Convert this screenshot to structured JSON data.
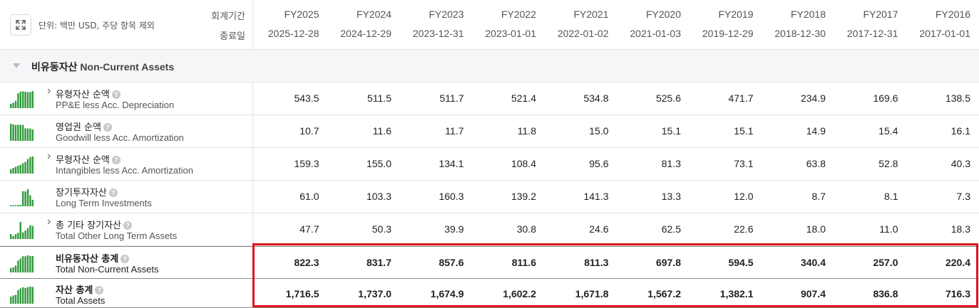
{
  "header": {
    "unit_label": "단위: 백만 USD, 주당 항목 제외",
    "period_label": "회계기간",
    "end_date_label": "종료일",
    "columns": [
      {
        "fy": "FY2025",
        "date": "2025-12-28"
      },
      {
        "fy": "FY2024",
        "date": "2024-12-29"
      },
      {
        "fy": "FY2023",
        "date": "2023-12-31"
      },
      {
        "fy": "FY2022",
        "date": "2023-01-01"
      },
      {
        "fy": "FY2021",
        "date": "2022-01-02"
      },
      {
        "fy": "FY2020",
        "date": "2021-01-03"
      },
      {
        "fy": "FY2019",
        "date": "2019-12-29"
      },
      {
        "fy": "FY2018",
        "date": "2018-12-30"
      },
      {
        "fy": "FY2017",
        "date": "2017-12-31"
      },
      {
        "fy": "FY2016",
        "date": "2017-01-01"
      }
    ]
  },
  "section": {
    "title_ko": "비유동자산",
    "title_en": "Non-Current Assets"
  },
  "rows": [
    {
      "name_ko": "유형자산 순액",
      "name_en": "PP&E less Acc. Depreciation",
      "expandable": true,
      "total": false,
      "values": [
        "543.5",
        "511.5",
        "511.7",
        "521.4",
        "534.8",
        "525.6",
        "471.7",
        "234.9",
        "169.6",
        "138.5"
      ]
    },
    {
      "name_ko": "영업권 순액",
      "name_en": "Goodwill less Acc. Amortization",
      "expandable": false,
      "total": false,
      "values": [
        "10.7",
        "11.6",
        "11.7",
        "11.8",
        "15.0",
        "15.1",
        "15.1",
        "14.9",
        "15.4",
        "16.1"
      ]
    },
    {
      "name_ko": "무형자산 순액",
      "name_en": "Intangibles less Acc. Amortization",
      "expandable": true,
      "total": false,
      "values": [
        "159.3",
        "155.0",
        "134.1",
        "108.4",
        "95.6",
        "81.3",
        "73.1",
        "63.8",
        "52.8",
        "40.3"
      ]
    },
    {
      "name_ko": "장기투자자산",
      "name_en": "Long Term Investments",
      "expandable": false,
      "total": false,
      "values": [
        "61.0",
        "103.3",
        "160.3",
        "139.2",
        "141.3",
        "13.3",
        "12.0",
        "8.7",
        "8.1",
        "7.3"
      ]
    },
    {
      "name_ko": "총 기타 장기자산",
      "name_en": "Total Other Long Term Assets",
      "expandable": true,
      "total": false,
      "values": [
        "47.7",
        "50.3",
        "39.9",
        "30.8",
        "24.6",
        "62.5",
        "22.6",
        "18.0",
        "11.0",
        "18.3"
      ]
    },
    {
      "name_ko": "비유동자산 총계",
      "name_en": "Total Non-Current Assets",
      "expandable": false,
      "total": true,
      "values": [
        "822.3",
        "831.7",
        "857.6",
        "811.6",
        "811.3",
        "697.8",
        "594.5",
        "340.4",
        "257.0",
        "220.4"
      ]
    },
    {
      "name_ko": "자산 총계",
      "name_en": "Total Assets",
      "expandable": false,
      "total": true,
      "values": [
        "1,716.5",
        "1,737.0",
        "1,674.9",
        "1,602.2",
        "1,671.8",
        "1,567.2",
        "1,382.1",
        "907.4",
        "836.8",
        "716.3"
      ]
    }
  ],
  "colors": {
    "sparkline": "#2e9a3a",
    "highlight": "#e0141b",
    "section_bg": "#f5f6f7"
  },
  "icons": {
    "expand": "expand-icon",
    "collapse": "triangle-down-icon",
    "row_expand": "chevron-right-icon",
    "help": "question-circle-icon",
    "sparkline": "bar-sparkline-icon"
  }
}
